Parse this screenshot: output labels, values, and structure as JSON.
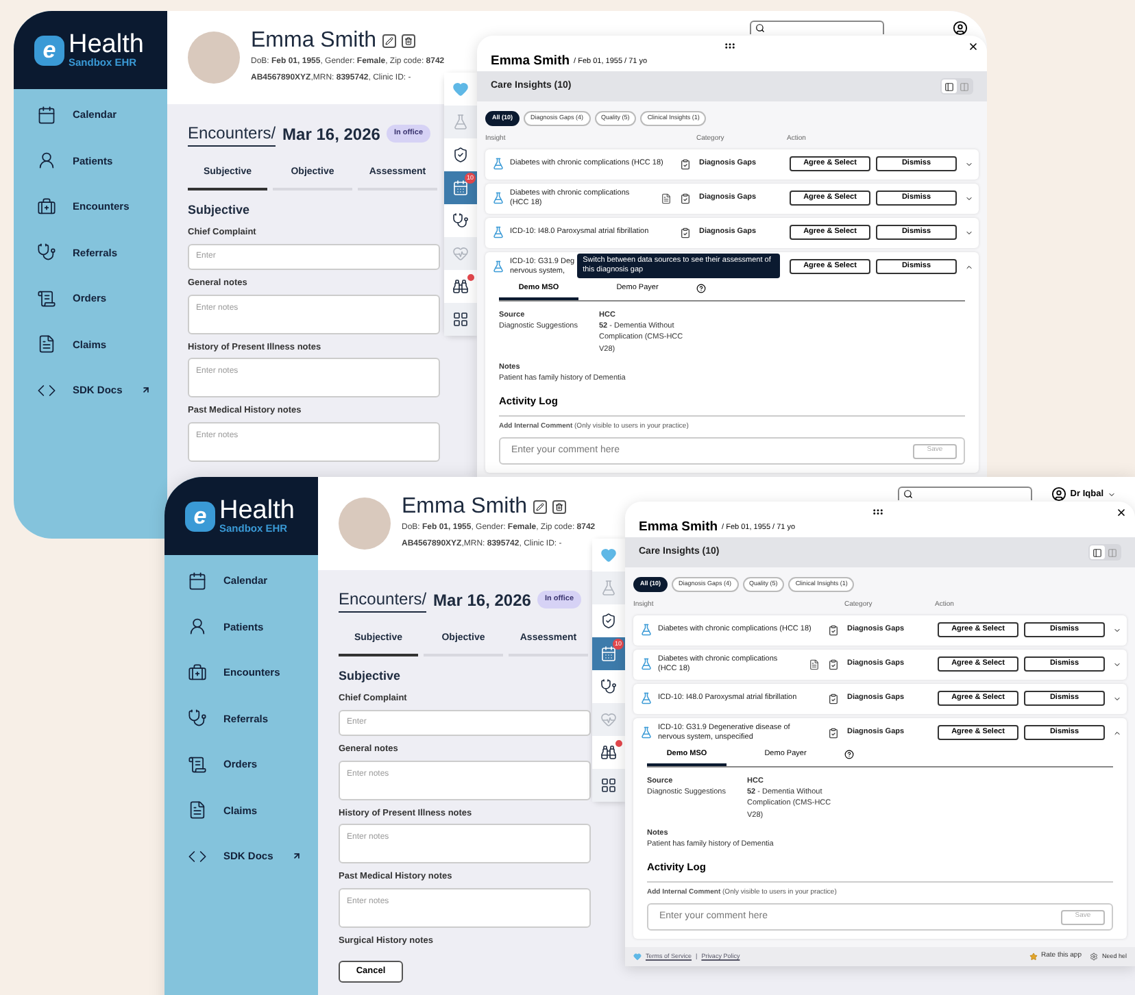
{
  "screens": [
    {
      "brand": {
        "letter": "e",
        "name": "Health",
        "subtitle": "Sandbox EHR"
      },
      "sidebar": [
        {
          "label": "Calendar",
          "external": false
        },
        {
          "label": "Patients",
          "external": false
        },
        {
          "label": "Encounters",
          "external": false
        },
        {
          "label": "Referrals",
          "external": false
        },
        {
          "label": "Orders",
          "external": false
        },
        {
          "label": "Claims",
          "external": false
        },
        {
          "label": "SDK Docs",
          "external": true
        }
      ],
      "patient": {
        "name": "Emma Smith",
        "line_1": "DoB: **Feb 01, 1955**, Gender: **Female**, Zip code: **8742**",
        "line_2": "**AB4567890XYZ**,MRN: **8395742**, Clinic ID: -"
      },
      "encounter": {
        "title": "Encounters/",
        "date": "Mar 16, 2026",
        "status": "In office"
      },
      "tabs": [
        {
          "label": "Subjective",
          "selected": true
        },
        {
          "label": "Objective",
          "selected": false
        },
        {
          "label": "Assessment",
          "selected": false
        }
      ],
      "section": "Subjective",
      "fields": [
        {
          "label": "Chief Complaint",
          "kind": "input",
          "placeholder": "Enter"
        },
        {
          "label": "General notes",
          "kind": "textarea",
          "placeholder": "Enter notes"
        },
        {
          "label": "History of Present Illness notes",
          "kind": "textarea",
          "placeholder": "Enter notes"
        },
        {
          "label": "Past Medical History notes",
          "kind": "textarea",
          "placeholder": "Enter notes"
        }
      ],
      "rail": [
        {
          "selected": false,
          "disabled": false,
          "alert": false
        },
        {
          "selected": false,
          "disabled": true,
          "alert": false
        },
        {
          "selected": false,
          "disabled": false,
          "alert": false
        },
        {
          "selected": true,
          "disabled": false,
          "alert": false,
          "badge": "10"
        },
        {
          "selected": false,
          "disabled": false,
          "alert": false
        },
        {
          "selected": false,
          "disabled": true,
          "alert": false
        },
        {
          "selected": false,
          "disabled": false,
          "alert": true
        },
        {
          "selected": false,
          "disabled": false,
          "alert": false
        }
      ],
      "insights": {
        "patient": "Emma Smith",
        "meta": "/ Feb 01, 1955 / 71 yo",
        "title": "Care Insights (10)",
        "view": [
          {
            "kind": "single",
            "selected": true
          },
          {
            "kind": "split",
            "selected": false
          }
        ],
        "filters": [
          {
            "label": "All (10)",
            "selected": true
          },
          {
            "label": "Diagnosis Gaps (4)",
            "selected": false
          },
          {
            "label": "Quality (5)",
            "selected": false
          },
          {
            "label": "Clinical Insights (1)",
            "selected": false
          }
        ],
        "columns": [
          "Insight",
          "Category",
          "Action"
        ],
        "rows": [
          {
            "title_lines": [
              "Diabetes with chronic complications (HCC 18)"
            ],
            "category": "Diagnosis Gaps",
            "report": false,
            "expanded": false,
            "actions": [
              "Agree & Select",
              "Dismiss"
            ]
          },
          {
            "title_lines": [
              "Diabetes with chronic complications",
              "(HCC 18)"
            ],
            "category": "Diagnosis Gaps",
            "report": true,
            "expanded": false,
            "actions": [
              "Agree & Select",
              "Dismiss"
            ]
          },
          {
            "title_lines": [
              "ICD-10: I48.0 Paroxysmal atrial fibrillation"
            ],
            "category": "Diagnosis Gaps",
            "report": false,
            "expanded": false,
            "actions": [
              "Agree & Select",
              "Dismiss"
            ]
          },
          {
            "title_lines": [
              "ICD-10: G31.9 Deg",
              "nervous system,"
            ],
            "report": false,
            "expanded": true,
            "actions": [
              "Agree & Select",
              "Dismiss"
            ],
            "tooltip": "Switch between data sources to see their assessment of this diagnosis gap",
            "detail": {
              "sources": [
                {
                  "label": "Demo MSO",
                  "selected": true
                },
                {
                  "label": "Demo Payer",
                  "selected": false
                }
              ],
              "source_label": "Source",
              "source_value": "Diagnostic Suggestions",
              "hcc_label": "HCC",
              "hcc_value": "**52** - Dementia Without Complication (CMS-HCC V28)",
              "notes_label": "Notes",
              "notes_value": "Patient has family history of Dementia",
              "log_title": "Activity Log",
              "comment_label": "**Add Internal Comment** (Only visible to users in your practice)",
              "comment_placeholder": "Enter your comment here",
              "save": "Save"
            }
          }
        ]
      }
    },
    {
      "brand": {
        "letter": "e",
        "name": "Health",
        "subtitle": "Sandbox EHR"
      },
      "sidebar": [
        {
          "label": "Calendar",
          "external": false
        },
        {
          "label": "Patients",
          "external": false
        },
        {
          "label": "Encounters",
          "external": false
        },
        {
          "label": "Referrals",
          "external": false
        },
        {
          "label": "Orders",
          "external": false
        },
        {
          "label": "Claims",
          "external": false
        },
        {
          "label": "SDK Docs",
          "external": true
        }
      ],
      "user": "Dr Iqbal",
      "patient": {
        "name": "Emma Smith",
        "line_1": "DoB: **Feb 01, 1955**, Gender: **Female**, Zip code: **8742**",
        "line_2": "**AB4567890XYZ**,MRN: **8395742**, Clinic ID: -"
      },
      "encounter": {
        "title": "Encounters/",
        "date": "Mar 16, 2026",
        "status": "In office"
      },
      "tabs": [
        {
          "label": "Subjective",
          "selected": true
        },
        {
          "label": "Objective",
          "selected": false
        },
        {
          "label": "Assessment",
          "selected": false
        }
      ],
      "section": "Subjective",
      "fields": [
        {
          "label": "Chief Complaint",
          "kind": "input",
          "placeholder": "Enter"
        },
        {
          "label": "General notes",
          "kind": "textarea",
          "placeholder": "Enter notes"
        },
        {
          "label": "History of Present Illness notes",
          "kind": "textarea",
          "placeholder": "Enter notes"
        },
        {
          "label": "Past Medical History notes",
          "kind": "textarea",
          "placeholder": "Enter notes"
        },
        {
          "label": "Surgical History notes",
          "kind": "label"
        }
      ],
      "cancel": "Cancel",
      "rail": [
        {
          "selected": false,
          "disabled": false,
          "alert": false
        },
        {
          "selected": false,
          "disabled": true,
          "alert": false
        },
        {
          "selected": false,
          "disabled": false,
          "alert": false
        },
        {
          "selected": true,
          "disabled": false,
          "alert": false,
          "badge": "10"
        },
        {
          "selected": false,
          "disabled": false,
          "alert": false
        },
        {
          "selected": false,
          "disabled": true,
          "alert": false
        },
        {
          "selected": false,
          "disabled": false,
          "alert": true
        },
        {
          "selected": false,
          "disabled": false,
          "alert": false
        }
      ],
      "insights": {
        "patient": "Emma Smith",
        "meta": "/ Feb 01, 1955 / 71 yo",
        "title": "Care Insights (10)",
        "view": [
          {
            "kind": "single",
            "selected": true
          },
          {
            "kind": "split",
            "selected": false
          }
        ],
        "filters": [
          {
            "label": "All (10)",
            "selected": true
          },
          {
            "label": "Diagnosis Gaps (4)",
            "selected": false
          },
          {
            "label": "Quality (5)",
            "selected": false
          },
          {
            "label": "Clinical Insights (1)",
            "selected": false
          }
        ],
        "columns": [
          "Insight",
          "Category",
          "Action"
        ],
        "rows": [
          {
            "title_lines": [
              "Diabetes with chronic complications (HCC 18)"
            ],
            "category": "Diagnosis Gaps",
            "report": false,
            "expanded": false,
            "actions": [
              "Agree & Select",
              "Dismiss"
            ]
          },
          {
            "title_lines": [
              "Diabetes with chronic complications",
              "(HCC 18)"
            ],
            "category": "Diagnosis Gaps",
            "report": true,
            "expanded": false,
            "actions": [
              "Agree & Select",
              "Dismiss"
            ]
          },
          {
            "title_lines": [
              "ICD-10: I48.0 Paroxysmal atrial fibrillation"
            ],
            "category": "Diagnosis Gaps",
            "report": false,
            "expanded": false,
            "actions": [
              "Agree & Select",
              "Dismiss"
            ]
          },
          {
            "title_lines": [
              "ICD-10: G31.9 Degenerative disease of",
              "nervous system, unspecified"
            ],
            "category": "Diagnosis Gaps",
            "report": false,
            "expanded": true,
            "actions": [
              "Agree & Select",
              "Dismiss"
            ],
            "detail": {
              "sources": [
                {
                  "label": "Demo MSO",
                  "selected": true
                },
                {
                  "label": "Demo Payer",
                  "selected": false
                }
              ],
              "source_label": "Source",
              "source_value": "Diagnostic Suggestions",
              "hcc_label": "HCC",
              "hcc_value": "**52** - Dementia Without Complication (CMS-HCC V28)",
              "notes_label": "Notes",
              "notes_value": "Patient has family history of Dementia",
              "log_title": "Activity Log",
              "comment_label": "**Add Internal Comment** (Only visible to users in your practice)",
              "comment_placeholder": "Enter your comment here",
              "save": "Save"
            }
          }
        ],
        "footer": {
          "links": [
            "Terms of Service",
            "Privacy Policy"
          ],
          "separator": "|",
          "rate": "Rate this app",
          "help": "Need hel"
        }
      }
    }
  ]
}
